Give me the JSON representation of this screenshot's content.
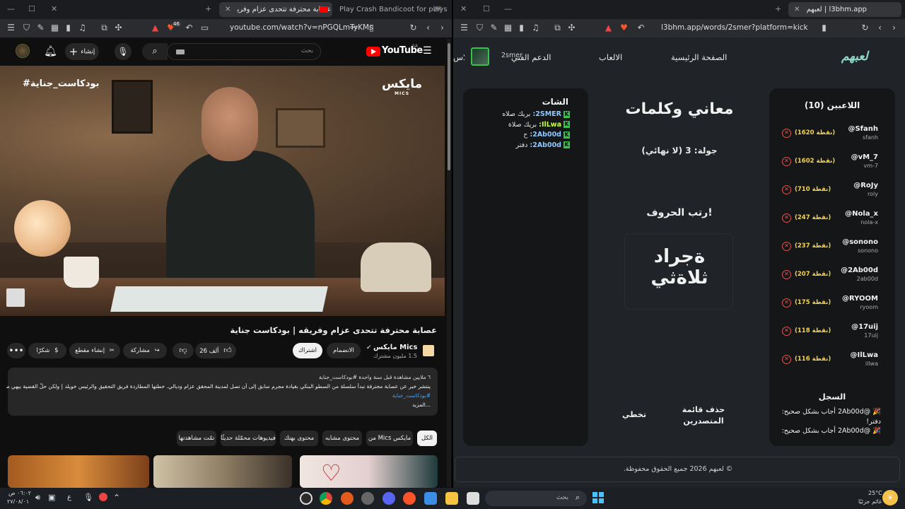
{
  "left_browser": {
    "tabs": [
      {
        "label": "Play Crash Bandicoot for playstation"
      },
      {
        "label": "عصابة محترفة تتحدى عزام وفرﻳ",
        "active": true
      }
    ],
    "url": "youtube.com/watch?v=nPGQLmTyKMs",
    "brave_count": "46"
  },
  "youtube": {
    "logo": "YouTube",
    "region": "SA",
    "search_placeholder": "بحث",
    "create_label": "إنشاء",
    "video": {
      "overlay_hashtag": "#بودكاست_جناية",
      "overlay_brand": "مايكس",
      "overlay_brand_sub": "MICS",
      "title": "عصابة محترفة تتحدى عزام وفريقه | بودكاست جناية"
    },
    "channel": {
      "name": "Mics مايكس",
      "subscribers": "1.5 مليون مشترك",
      "join_label": "الانضمام",
      "subscribe_label": "اشتراك"
    },
    "actions": {
      "like_count": "26 ألف",
      "share_label": "مشاركة",
      "clip_label": "إنشاء مقطع",
      "thanks_label": "شكرًا"
    },
    "description": {
      "meta": "٦ ملايين مشاهدة  قبل سنة واحدة  #بودكاست_جناية",
      "text": "ينتشر خبر عن عصابة محترفة تبدأ سلسلة من السطو البنكي بقيادة مجرم سابق إلى أن تصل لمدينة المحقق عزام وديالي. خطتها المطاردة فريق التحقيق والرئيس خويلد | ولكن حلّ القضية بيهي موسم",
      "hashtag": "#بودكاست_جناية",
      "more": "...المزيد"
    },
    "chips": [
      {
        "label": "الكل",
        "selected": true
      },
      {
        "label": "من Mics مايكس"
      },
      {
        "label": "محتوى مشابه"
      },
      {
        "label": "محتوى بهتك"
      },
      {
        "label": "فيديوهات محمّلة حديثًا"
      },
      {
        "label": "تمّت مشاهدتها"
      }
    ]
  },
  "right_browser": {
    "tabs": [
      {
        "label": "لعبهم | l3bhm.app",
        "active": true
      }
    ],
    "url": "l3bhm.app/words/2smer?platform=kick"
  },
  "site": {
    "logo": "لعبهم",
    "nav": [
      "الصفحة الرئيسية",
      "الالعاب",
      "الدعم الفني",
      "الاس"
    ],
    "user_handle": "2smer",
    "players_title": "اللاعبين (10)",
    "players": [
      {
        "name": "@Sfanh",
        "sub": "sfanh",
        "points": "(1620 نقطة)"
      },
      {
        "name": "@vM_7",
        "sub": "vm-7",
        "points": "(1602 نقطة)"
      },
      {
        "name": "@RoJy",
        "sub": "roly",
        "points": "(710 نقطة)"
      },
      {
        "name": "@Nola_x",
        "sub": "nola-x",
        "points": "(247 نقطة)"
      },
      {
        "name": "@sonono",
        "sub": "sonono",
        "points": "(237 نقطة)"
      },
      {
        "name": "@2Ab00d",
        "sub": "2ab00d",
        "points": "(207 نقطة)"
      },
      {
        "name": "@RYOOM",
        "sub": "ryoom",
        "points": "(175 نقطة)"
      },
      {
        "name": "@17uij",
        "sub": "17uij",
        "points": "(118 نقطة)"
      },
      {
        "name": "@IlLwa",
        "sub": "illwa",
        "points": "(116 نقطة)"
      }
    ],
    "game_title": "معاني وكلمات",
    "round": "جولة: 3 (لا نهائي)",
    "instruction": "رتب الحروف!",
    "scrambled_line1": "ةجراد",
    "scrambled_line2": "ثلاةثي",
    "delete_label": "حذف قائمة المتصدرين",
    "skip_label": "تخطي",
    "chat_title": "الشات",
    "chat": [
      {
        "user": "2SMER:",
        "msg": "بريك صلاه",
        "color": "#8fc8ff"
      },
      {
        "user": "IlLwa:",
        "msg": "بريك صلاة",
        "color": "#c7ff4a"
      },
      {
        "user": "2Ab00d:",
        "msg": "ح",
        "color": "#8fc8ff"
      },
      {
        "user": "2Ab00d:",
        "msg": "دفتر",
        "color": "#8fc8ff"
      }
    ],
    "log_title": "السجل",
    "log": [
      {
        "line": "🎉 @2Ab00d أجاب بشكل صحيح:",
        "answer": "دفتر!"
      },
      {
        "line": "🎉 @2Ab00d أجاب بشكل صحيح:",
        "answer": ""
      }
    ],
    "footer": "© لعبهم 2026 جميع الحقوق محفوظة."
  },
  "taskbar": {
    "weather_temp": "25°C",
    "weather_desc": "غائم جزئيًا",
    "search_placeholder": "بحث",
    "time": "٠٦:٠٢ ص",
    "date": "٢٧/٠٨/٠١",
    "lang": "ع"
  },
  "colors": {
    "yt_red": "#ff0000",
    "site_bg": "#202327",
    "panel_bg": "#141618",
    "points_yellow": "#f5d44a",
    "remove_red": "#e55353",
    "kick_green": "#35c24a"
  }
}
